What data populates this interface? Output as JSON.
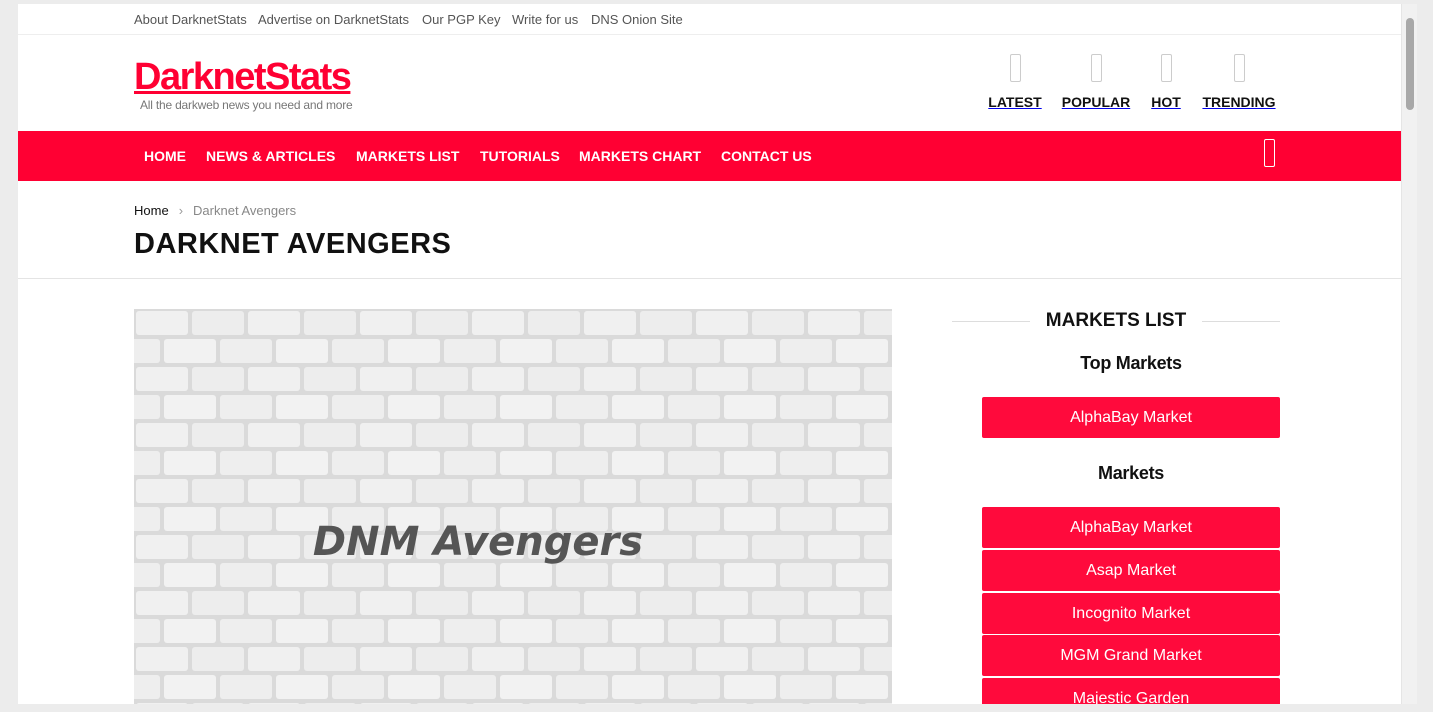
{
  "topbar": {
    "links": [
      "About DarknetStats",
      "Advertise on DarknetStats",
      "Our PGP Key",
      "Write for us",
      "DNS Onion Site"
    ]
  },
  "header": {
    "logo": "DarknetStats",
    "tagline": "All the darkweb news you need and more",
    "quick_nav": [
      "LATEST",
      "POPULAR",
      "HOT",
      "TRENDING"
    ]
  },
  "main_nav": {
    "items": [
      "HOME",
      "NEWS & ARTICLES",
      "MARKETS LIST",
      "TUTORIALS",
      "MARKETS CHART",
      "CONTACT US"
    ],
    "search_icon": "search-icon"
  },
  "breadcrumb": {
    "home": "Home",
    "separator": "›",
    "current": "Darknet Avengers"
  },
  "page": {
    "title": "DARKNET AVENGERS",
    "featured_image_text": "DNM Avengers"
  },
  "sidebar": {
    "widget_title": "MARKETS LIST",
    "top_markets_heading": "Top Markets",
    "top_markets": [
      "AlphaBay Market"
    ],
    "markets_heading": "Markets",
    "markets": [
      "AlphaBay Market",
      "Asap Market",
      "Incognito Market",
      "MGM Grand Market",
      "Majestic Garden"
    ]
  },
  "colors": {
    "brand_red": "#ff0033",
    "button_red": "#ff0a3c"
  }
}
